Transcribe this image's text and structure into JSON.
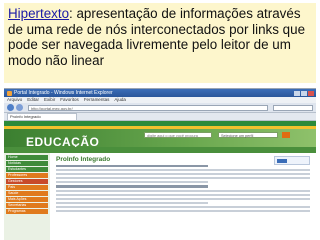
{
  "caption": {
    "link_text": "Hipertexto",
    "rest_text": ": apresentação de informações através de uma rede de nós interconectados por links que pode ser navegada livremente pelo leitor de um modo não linear"
  },
  "browser": {
    "window_title": "Portal Integrado - Windows Internet Explorer",
    "menu": [
      "Arquivo",
      "Editar",
      "Exibir",
      "Favoritos",
      "Ferramentas",
      "Ajuda"
    ],
    "address": "http://portal.mec.gov.br/",
    "tab_title": "Proinfo Integrado"
  },
  "site": {
    "logo": "EDUCAÇÃO",
    "search_placeholder": "digite aqui o que você procura",
    "select_value": "Selecione um perfil",
    "sidebar": [
      "Home",
      "Notícias",
      "Estudantes",
      "Professores",
      "Gestores",
      "Pais",
      "Saúde",
      "Mais Ações",
      "Secretarias",
      "Programas"
    ],
    "page_title": "ProInfo Integrado"
  },
  "colors": {
    "caption_bg": "#fdf6cc",
    "link": "#1a1aa6",
    "site_green": "#3f8b3a"
  }
}
